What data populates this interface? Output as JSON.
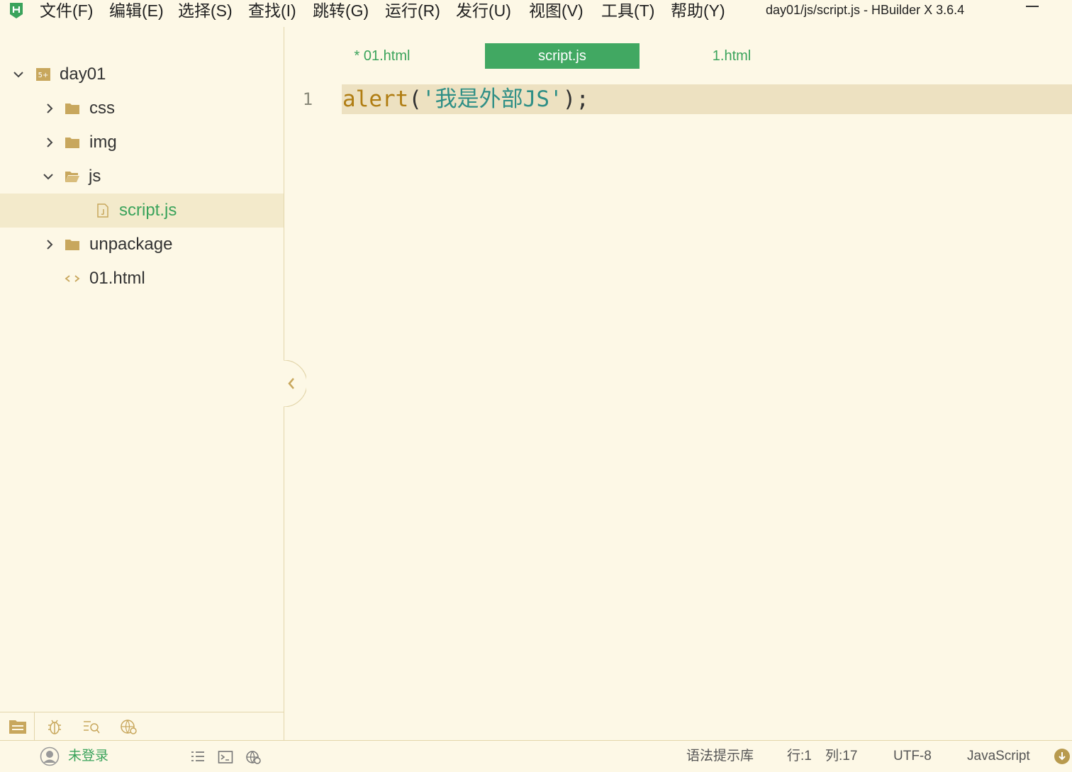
{
  "menubar": {
    "items": [
      "文件(F)",
      "编辑(E)",
      "选择(S)",
      "查找(I)",
      "跳转(G)",
      "运行(R)",
      "发行(U)",
      "视图(V)",
      "工具(T)",
      "帮助(Y)"
    ],
    "window_title": "day01/js/script.js - HBuilder X 3.6.4"
  },
  "sidebar": {
    "tree": [
      {
        "label": "day01",
        "type": "project",
        "expanded": true
      },
      {
        "label": "css",
        "type": "folder",
        "expanded": false
      },
      {
        "label": "img",
        "type": "folder",
        "expanded": false
      },
      {
        "label": "js",
        "type": "folder",
        "expanded": true
      },
      {
        "label": "script.js",
        "type": "js-file",
        "selected": true
      },
      {
        "label": "unpackage",
        "type": "folder",
        "expanded": false
      },
      {
        "label": "01.html",
        "type": "html-file"
      }
    ],
    "bottom_tabs": [
      "project-explorer-icon",
      "debug-bug-icon",
      "search-icon",
      "web-globe-icon"
    ]
  },
  "editor": {
    "tabs": [
      {
        "label": "* 01.html",
        "active": false
      },
      {
        "label": "script.js",
        "active": true
      },
      {
        "label": "1.html",
        "active": false
      }
    ],
    "line_number": "1",
    "code": {
      "fn": "alert",
      "open": "(",
      "string": "'我是外部JS'",
      "close": ");"
    }
  },
  "statusbar": {
    "login": "未登录",
    "syntax_lib": "语法提示库",
    "row": "行:1",
    "col": "列:17",
    "encoding": "UTF-8",
    "language": "JavaScript"
  },
  "colors": {
    "background": "#fdf8e6",
    "accent_green": "#41a862",
    "folder": "#c8a75d",
    "current_line": "#ede1c1"
  }
}
